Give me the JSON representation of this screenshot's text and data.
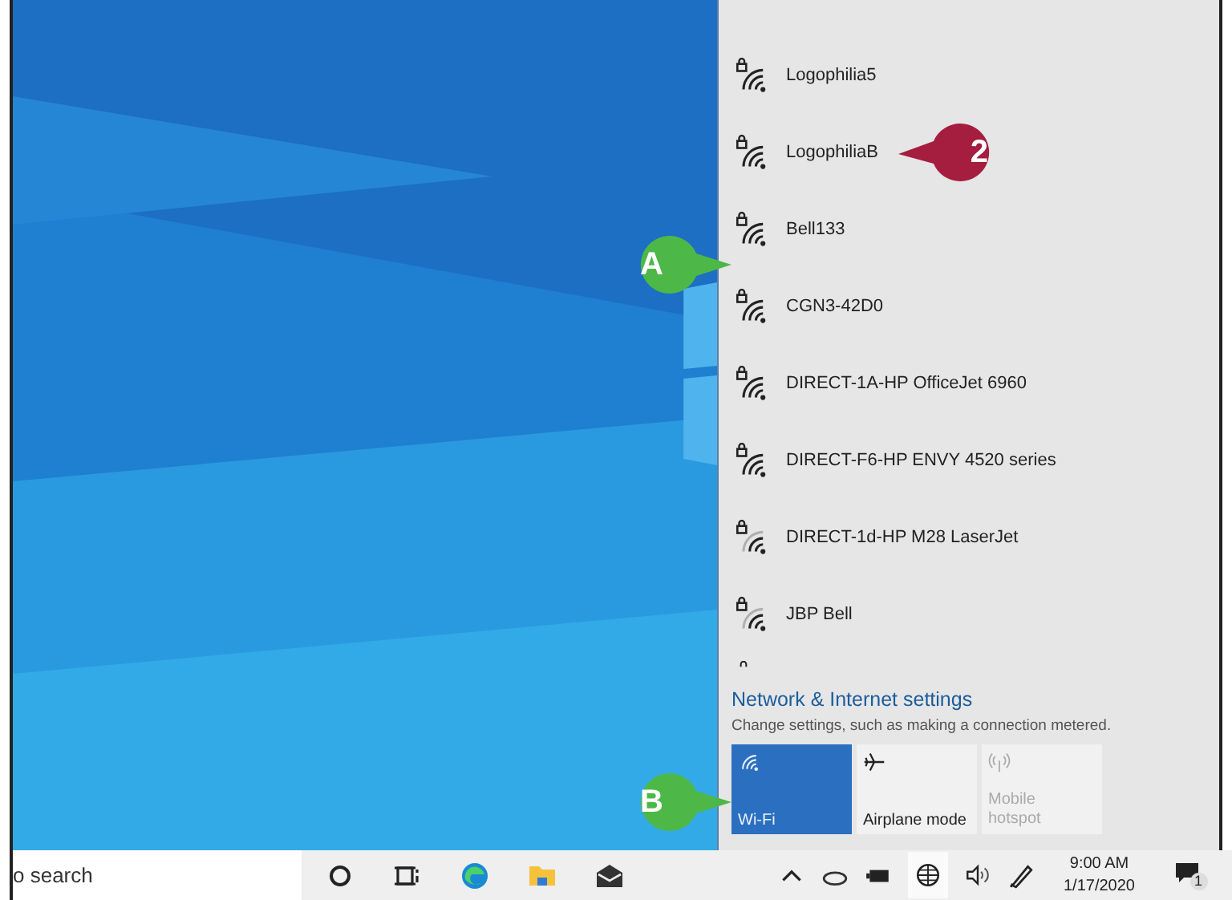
{
  "networks": [
    {
      "name": "Logophilia5",
      "kind": "strong"
    },
    {
      "name": "LogophiliaB",
      "kind": "strong"
    },
    {
      "name": "Bell133",
      "kind": "strong"
    },
    {
      "name": "CGN3-42D0",
      "kind": "strong"
    },
    {
      "name": "DIRECT-1A-HP OfficeJet 6960",
      "kind": "strong"
    },
    {
      "name": "DIRECT-F6-HP ENVY 4520 series",
      "kind": "strong"
    },
    {
      "name": "DIRECT-1d-HP M28 LaserJet",
      "kind": "weak"
    },
    {
      "name": "JBP Bell",
      "kind": "weak"
    }
  ],
  "settings_link": "Network & Internet settings",
  "settings_note": "Change settings, such as making a connection metered.",
  "quick_actions": [
    {
      "label": "Wi-Fi",
      "kind": "wifi",
      "selected": true,
      "disabled": false
    },
    {
      "label": "Airplane mode",
      "kind": "airplane",
      "selected": false,
      "disabled": false
    },
    {
      "label": "Mobile hotspot",
      "kind": "hotspot",
      "selected": false,
      "disabled": true
    }
  ],
  "taskbar": {
    "search_text": "o search",
    "clock_time": "9:00 AM",
    "clock_date": "1/17/2020",
    "notification_count": "1"
  },
  "callouts": [
    {
      "label": "2",
      "color": "#a51d3f",
      "kind": "left"
    },
    {
      "label": "A",
      "color": "#4db848",
      "kind": "right"
    },
    {
      "label": "B",
      "color": "#4db848",
      "kind": "right"
    }
  ]
}
